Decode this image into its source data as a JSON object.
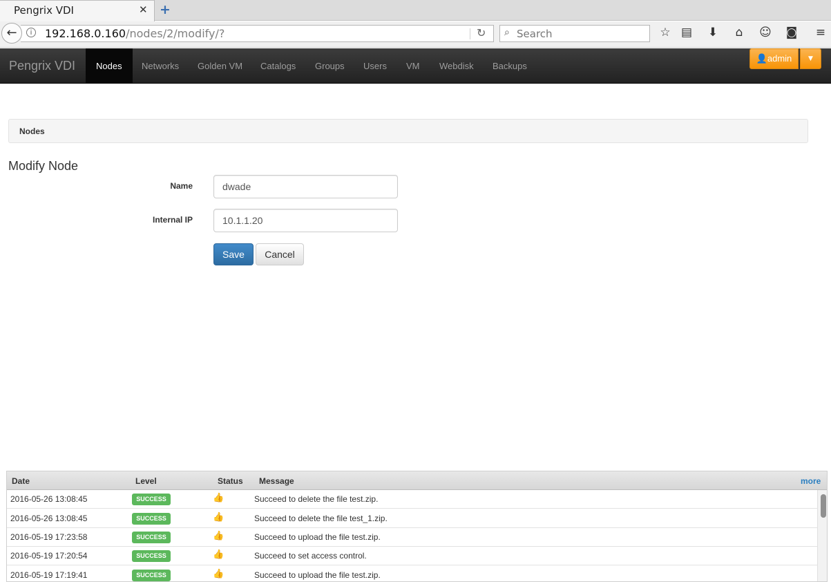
{
  "browser": {
    "tab_title": "Pengrix VDI",
    "tab_close": "✕",
    "new_tab": "+",
    "url_host": "192.168.0.160",
    "url_path": "/nodes/2/modify/?",
    "search_placeholder": "Search"
  },
  "app": {
    "brand": "Pengrix VDI",
    "nav": [
      {
        "label": "Nodes",
        "active": true
      },
      {
        "label": "Networks"
      },
      {
        "label": "Golden VM"
      },
      {
        "label": "Catalogs"
      },
      {
        "label": "Groups"
      },
      {
        "label": "Users"
      },
      {
        "label": "VM"
      },
      {
        "label": "Webdisk"
      },
      {
        "label": "Backups"
      }
    ],
    "user_label": "admin",
    "accent_color": "#f89406"
  },
  "breadcrumb": "Nodes",
  "form": {
    "title": "Modify Node",
    "name_label": "Name",
    "name_value": "dwade",
    "ip_label": "Internal IP",
    "ip_value": "10.1.1.20",
    "save_label": "Save",
    "cancel_label": "Cancel"
  },
  "log": {
    "headers": {
      "date": "Date",
      "level": "Level",
      "status": "Status",
      "message": "Message",
      "more": "more"
    },
    "rows": [
      {
        "date": "2016-05-26 13:08:45",
        "level": "SUCCESS",
        "message": "Succeed to delete the file test.zip."
      },
      {
        "date": "2016-05-26 13:08:45",
        "level": "SUCCESS",
        "message": "Succeed to delete the file test_1.zip."
      },
      {
        "date": "2016-05-19 17:23:58",
        "level": "SUCCESS",
        "message": "Succeed to upload the file test.zip."
      },
      {
        "date": "2016-05-19 17:20:54",
        "level": "SUCCESS",
        "message": "Succeed to set access control."
      },
      {
        "date": "2016-05-19 17:19:41",
        "level": "SUCCESS",
        "message": "Succeed to upload the file test.zip."
      }
    ],
    "success_color": "#5cb85c"
  }
}
